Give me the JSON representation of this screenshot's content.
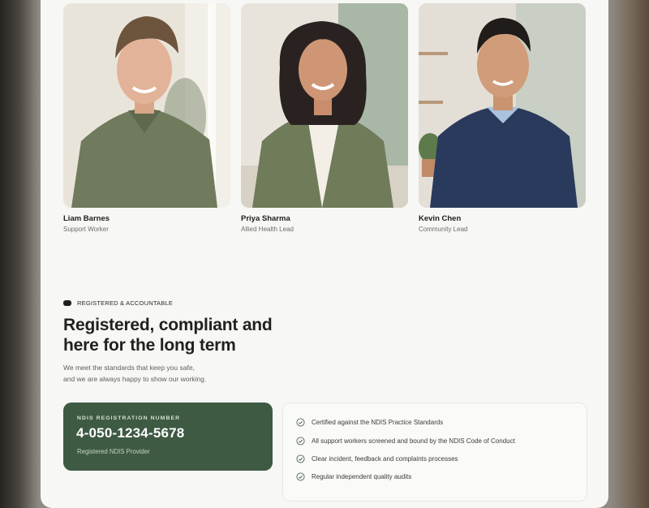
{
  "team": {
    "members": [
      {
        "name": "Liam Barnes",
        "role": "Support Worker"
      },
      {
        "name": "Priya Sharma",
        "role": "Allied Health Lead"
      },
      {
        "name": "Kevin Chen",
        "role": "Community Lead"
      }
    ]
  },
  "compliance": {
    "tag_label": "REGISTERED & ACCOUNTABLE",
    "heading_line1": "Registered, compliant and",
    "heading_line2": "here for the long term",
    "body_line1": "We meet the standards that keep you safe,",
    "body_line2": "and we are always happy to show our working."
  },
  "registration": {
    "label": "NDIS REGISTRATION NUMBER",
    "number": "4-050-1234-5678",
    "subtitle": "Registered NDIS Provider"
  },
  "checklist": {
    "items": [
      "Certified against the NDIS Practice Standards",
      "All support workers screened and bound by the NDIS Code of Conduct",
      "Clear incident, feedback and complaints processes",
      "Regular independent quality audits"
    ]
  },
  "colors": {
    "card_green": "#3e5a43",
    "page_background": "#f7f7f5",
    "text_dark": "#1f211f"
  }
}
